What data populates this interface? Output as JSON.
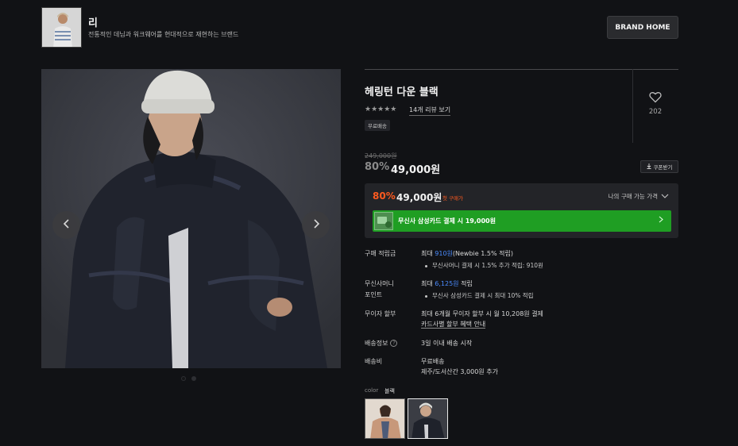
{
  "brand": {
    "name": "리",
    "description": "전통적인 데님과 워크웨어를 현대적으로 재현하는 브랜드",
    "home_button": "BRAND HOME"
  },
  "gallery": {
    "prev_icon": "chevron-left-icon",
    "next_icon": "chevron-right-icon",
    "dots_count": 2,
    "active_dot": 1
  },
  "product": {
    "title": "헤링턴 다운 블랙",
    "rating_stars": "★★★★★",
    "review_link": "14개 리뷰 보기",
    "badge": "무료배송",
    "wish_count": "202",
    "original_price": "249,000원",
    "discount_rate": "80%",
    "sale_price": "49,000원",
    "coupon_button": "쿠폰받기"
  },
  "best_price": {
    "rate": "80%",
    "price": "49,000원",
    "label": "첫 구매가",
    "my_price_toggle": "나의 구매 가능 가격",
    "card_banner": "무신사 삼성카드 결제 시 19,000원"
  },
  "info": {
    "points_label": "구매 적립금",
    "points_prefix": "최대 ",
    "points_amount": "910원",
    "points_suffix": "(Newbie 1.5% 적립)",
    "points_sub": "무신사머니 결제 시 1.5% 추가 적립: 910원",
    "money_label_1": "무신사머니",
    "money_label_2": "포인트",
    "money_prefix": "최대 ",
    "money_amount": "6,125원",
    "money_suffix": " 적립",
    "money_sub": "무신사 삼성카드 결제 시 최대 10% 적립",
    "installment_label": "무이자 할부",
    "installment_value": "최대 6개월 무이자 할부 시 월 10,208원 결제",
    "installment_link": "카드사별 할부 혜택 안내",
    "shipping_info_label": "배송정보",
    "shipping_info_help": "?",
    "shipping_info_value": "3일 이내 배송 시작",
    "shipping_fee_label": "배송비",
    "shipping_fee_value": "무료배송",
    "shipping_fee_sub": "제주/도서산간 3,000원 추가"
  },
  "color": {
    "label": "color",
    "value": "블랙"
  },
  "colors": {
    "accent_orange": "#ff5a1f",
    "accent_blue": "#4b8cff",
    "banner_green": "#1f9e23",
    "background": "#111215"
  }
}
